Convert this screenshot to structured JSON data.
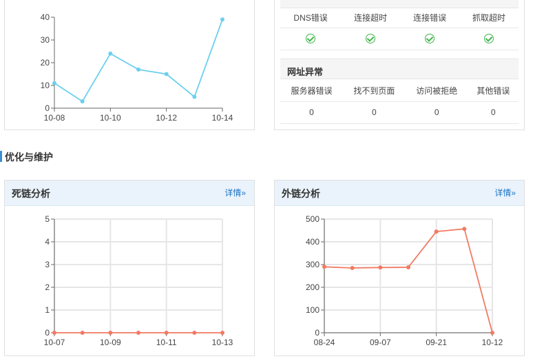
{
  "crawl_panel": {
    "chart": {
      "x_labels": [
        "10-08",
        "10-10",
        "10-12",
        "10-14"
      ],
      "y_labels": [
        "0",
        "10",
        "20",
        "30",
        "40"
      ],
      "color": "#6ccfef"
    }
  },
  "error_panel": {
    "crawl_errors": {
      "headers": [
        "DNS错误",
        "连接超时",
        "连接错误",
        "抓取超时"
      ],
      "status_icon": "check-icon"
    },
    "url_errors": {
      "title": "网址异常",
      "headers": [
        "服务器错误",
        "找不到页面",
        "访问被拒绝",
        "其他错误"
      ],
      "values": [
        "0",
        "0",
        "0",
        "0"
      ]
    }
  },
  "section": {
    "title": "优化与维护"
  },
  "dead_link_panel": {
    "title": "死链分析",
    "link": "详情»",
    "chart": {
      "x_labels": [
        "10-07",
        "10-09",
        "10-11",
        "10-13"
      ],
      "y_labels": [
        "0",
        "1",
        "2",
        "3",
        "4",
        "5"
      ],
      "color": "#f27a63"
    }
  },
  "outlink_panel": {
    "title": "外链分析",
    "link": "详情»",
    "chart": {
      "x_labels": [
        "08-24",
        "09-07",
        "09-21",
        "10-12"
      ],
      "y_labels": [
        "0",
        "100",
        "200",
        "300",
        "400",
        "500"
      ],
      "color": "#f27a63"
    }
  },
  "chart_data": [
    {
      "type": "line",
      "x": [
        "10-08",
        "10-09",
        "10-10",
        "10-11",
        "10-12",
        "10-13",
        "10-14"
      ],
      "values": [
        11,
        3,
        24,
        17,
        15,
        5,
        39
      ],
      "ylim": [
        0,
        40
      ],
      "grid": false
    },
    {
      "type": "line",
      "title": "死链分析",
      "x": [
        "10-07",
        "10-08",
        "10-09",
        "10-10",
        "10-11",
        "10-12",
        "10-13"
      ],
      "values": [
        0,
        0,
        0,
        0,
        0,
        0,
        0
      ],
      "ylim": [
        0,
        5
      ],
      "grid": true
    },
    {
      "type": "line",
      "title": "外链分析",
      "x": [
        "08-24",
        "08-31",
        "09-07",
        "09-14",
        "09-21",
        "09-28",
        "10-12"
      ],
      "values": [
        290,
        285,
        287,
        288,
        445,
        457,
        0
      ],
      "ylim": [
        0,
        500
      ],
      "grid": true
    }
  ]
}
